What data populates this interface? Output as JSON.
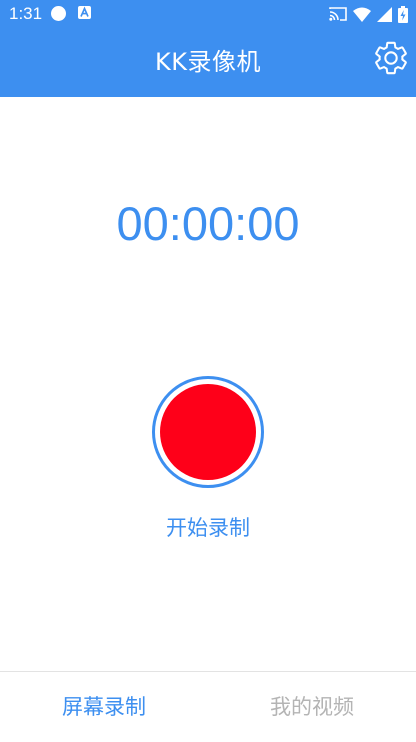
{
  "status_bar": {
    "time": "1:31",
    "icons": [
      "notification-dot-icon",
      "a-badge-icon",
      "cast-icon",
      "wifi-icon",
      "cell-signal-icon",
      "battery-icon"
    ]
  },
  "app_bar": {
    "title": "KK录像机",
    "settings_icon": "gear-icon",
    "background_color": "#3d8ff0"
  },
  "recorder": {
    "timer": "00:00:00",
    "record_button_color": "#fe0019",
    "record_label": "开始录制"
  },
  "bottom_nav": {
    "tabs": [
      {
        "label": "屏幕录制",
        "active": true
      },
      {
        "label": "我的视频",
        "active": false
      }
    ],
    "active_color": "#3d8ff0",
    "inactive_color": "#b4b4b4"
  }
}
